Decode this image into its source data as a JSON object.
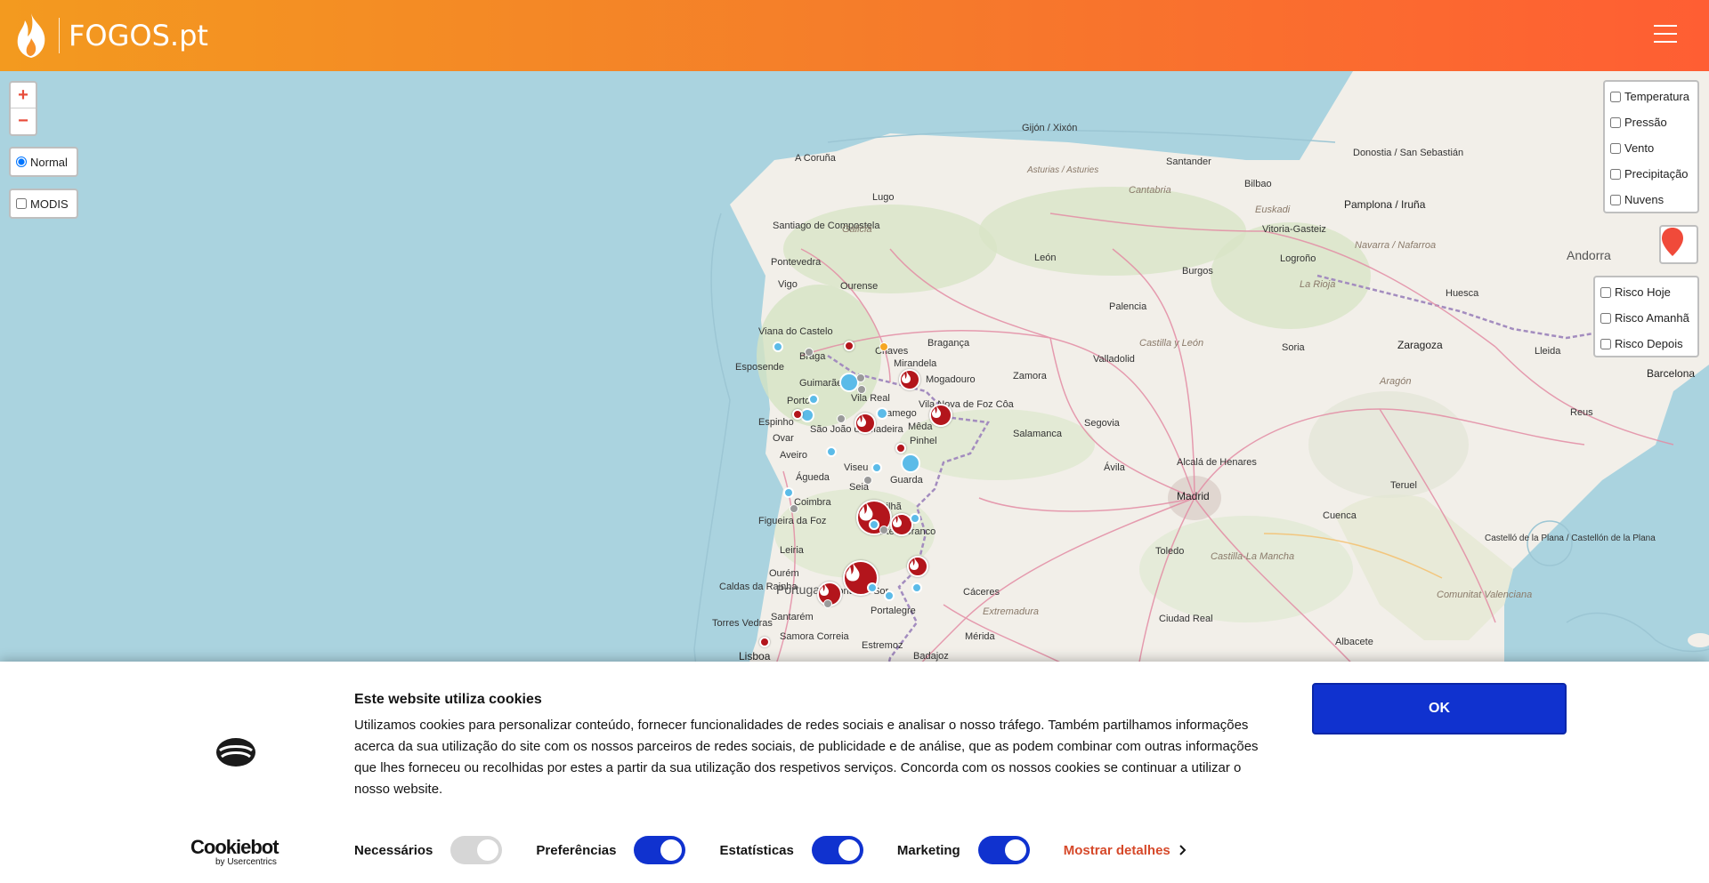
{
  "header": {
    "logo_text": "FOGOS.pt",
    "colors": {
      "gradient_start": "#f39a1f",
      "gradient_end": "#ff5e33"
    }
  },
  "zoom": {
    "in_label": "+",
    "out_label": "−"
  },
  "base_layers": [
    {
      "label": "Normal",
      "checked": true
    },
    {
      "label": "MODIS",
      "checked": false
    }
  ],
  "weather_layers": [
    {
      "label": "Temperatura"
    },
    {
      "label": "Pressão"
    },
    {
      "label": "Vento"
    },
    {
      "label": "Precipitação"
    },
    {
      "label": "Nuvens"
    }
  ],
  "risk_layers": [
    {
      "label": "Risco Hoje"
    },
    {
      "label": "Risco Amanhã"
    },
    {
      "label": "Risco Depois"
    }
  ],
  "map_places": {
    "gijon": "Gijón / Xixón",
    "acoruna": "A Coruña",
    "santander": "Santander",
    "donostia": "Donostia / San Sebastián",
    "bilbao": "Bilbao",
    "asturias": "Asturias / Asturies",
    "cantabria": "Cantabria",
    "euskadi": "Euskadi",
    "pamplona": "Pamplona / Iruña",
    "lugo": "Lugo",
    "santiago": "Santiago de Compostela",
    "galicia": "Galicia",
    "vitoria": "Vitoria-Gasteiz",
    "navarra": "Navarra / Nafarroa",
    "leon": "León",
    "pontevedra": "Pontevedra",
    "burgos": "Burgos",
    "logrono": "Logroño",
    "andorra": "Andorra",
    "vigo": "Vigo",
    "ourense": "Ourense",
    "larioja": "La Rioja",
    "huesca": "Huesca",
    "palencia": "Palencia",
    "viana": "Viana do Castelo",
    "braga": "Braga",
    "chaves": "Chaves",
    "braganca": "Bragança",
    "castilla": "Castilla y León",
    "zaragoza": "Zaragoza",
    "soria": "Soria",
    "lleida": "Lleida",
    "esposende": "Esposende",
    "mirandela": "Mirandela",
    "valladolid": "Valladolid",
    "guimaraes": "Guimarães",
    "mogadouro": "Mogadouro",
    "zamora": "Zamora",
    "barcelona": "Barcelona",
    "porto": "Porto",
    "vilareal": "Vila Real",
    "aragon": "Aragón",
    "lamego": "Lamego",
    "vilanova": "Vila Nova de Foz Côa",
    "reus": "Reus",
    "espinho": "Espinho",
    "saojoao": "São João da Madeira",
    "meda": "Mêda",
    "segovia": "Segovia",
    "ovar": "Ovar",
    "pinhel": "Pinhel",
    "salamanca": "Salamanca",
    "aveiro": "Aveiro",
    "viseu": "Viseu",
    "avila": "Ávila",
    "alcala": "Alcalá de Henares",
    "agueda": "Águeda",
    "guarda": "Guarda",
    "madrid": "Madrid",
    "teruel": "Teruel",
    "seia": "Seia",
    "coimbra": "Coimbra",
    "covilha": "Covilhã",
    "cuenca": "Cuenca",
    "figueira": "Figueira da Foz",
    "castelobranco": "Castelo Branco",
    "castello": "Castelló de la Plana / Castellón de la Plana",
    "leiria": "Leiria",
    "toledo": "Toledo",
    "castillalamancha": "Castilla-La Mancha",
    "ourem": "Ourém",
    "caldas": "Caldas da Rainha",
    "portugal": "Portugal",
    "pontesor": "Ponte de Sor",
    "caceres": "Cáceres",
    "comunitat": "Comunitat Valenciana",
    "torres": "Torres Vedras",
    "santarem": "Santarém",
    "portalegre": "Portalegre",
    "extremadura": "Extremadura",
    "ciudadreal": "Ciudad Real",
    "samora": "Samora Correia",
    "merida": "Mérida",
    "albacete": "Albacete",
    "lisboa": "Lisboa",
    "estremoz": "Estremoz",
    "badajoz": "Badajoz"
  },
  "cookie": {
    "title": "Este website utiliza cookies",
    "text": "Utilizamos cookies para personalizar conteúdo, fornecer funcionalidades de redes sociais e analisar o nosso tráfego. Também partilhamos informações acerca da sua utilização do site com os nossos parceiros de redes sociais, de publicidade e de análise, que as podem combinar com outras informações que lhes forneceu ou recolhidas por estes a partir da sua utilização dos respetivos serviços. Concorda com os nossos cookies se continuar a utilizar o nosso website.",
    "ok_label": "OK",
    "brand": "Cookiebot",
    "brand_sub": "by Usercentrics",
    "toggles": [
      {
        "label": "Necessários",
        "on": true,
        "disabled": true
      },
      {
        "label": "Preferências",
        "on": true
      },
      {
        "label": "Estatísticas",
        "on": true
      },
      {
        "label": "Marketing",
        "on": true
      }
    ],
    "details_label": "Mostrar detalhes",
    "colors": {
      "primary": "#1032cf",
      "link": "#d6492a"
    }
  }
}
